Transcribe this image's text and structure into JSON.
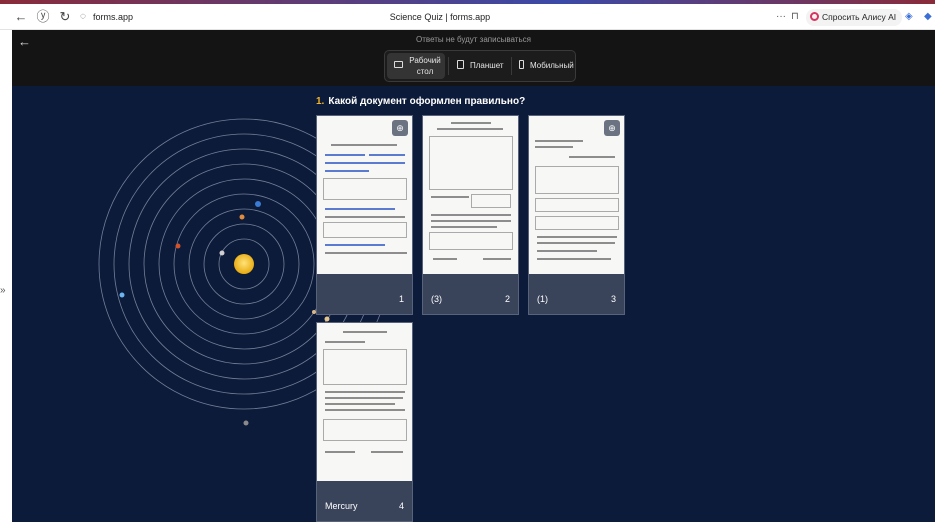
{
  "browser": {
    "address": "forms.app",
    "tab_title": "Science Quiz | forms.app",
    "alice_label": "Спросить Алису AI"
  },
  "header": {
    "notice": "Ответы не будут записываться",
    "devices": [
      {
        "label": "Рабочий стол",
        "icon": "desktop-icon"
      },
      {
        "label": "Планшет",
        "icon": "tablet-icon"
      },
      {
        "label": "Мобильный",
        "icon": "mobile-icon"
      }
    ]
  },
  "question": {
    "number": "1.",
    "text": "Какой документ оформлен правильно?"
  },
  "options": [
    {
      "label": "",
      "index": "1"
    },
    {
      "label": "(3)",
      "index": "2"
    },
    {
      "label": "(1)",
      "index": "3"
    },
    {
      "label": "Mercury",
      "index": "4"
    }
  ],
  "colors": {
    "background": "#0d1b3a",
    "header": "#141414",
    "sun": "#f5c518",
    "question_number": "#f0b429"
  }
}
